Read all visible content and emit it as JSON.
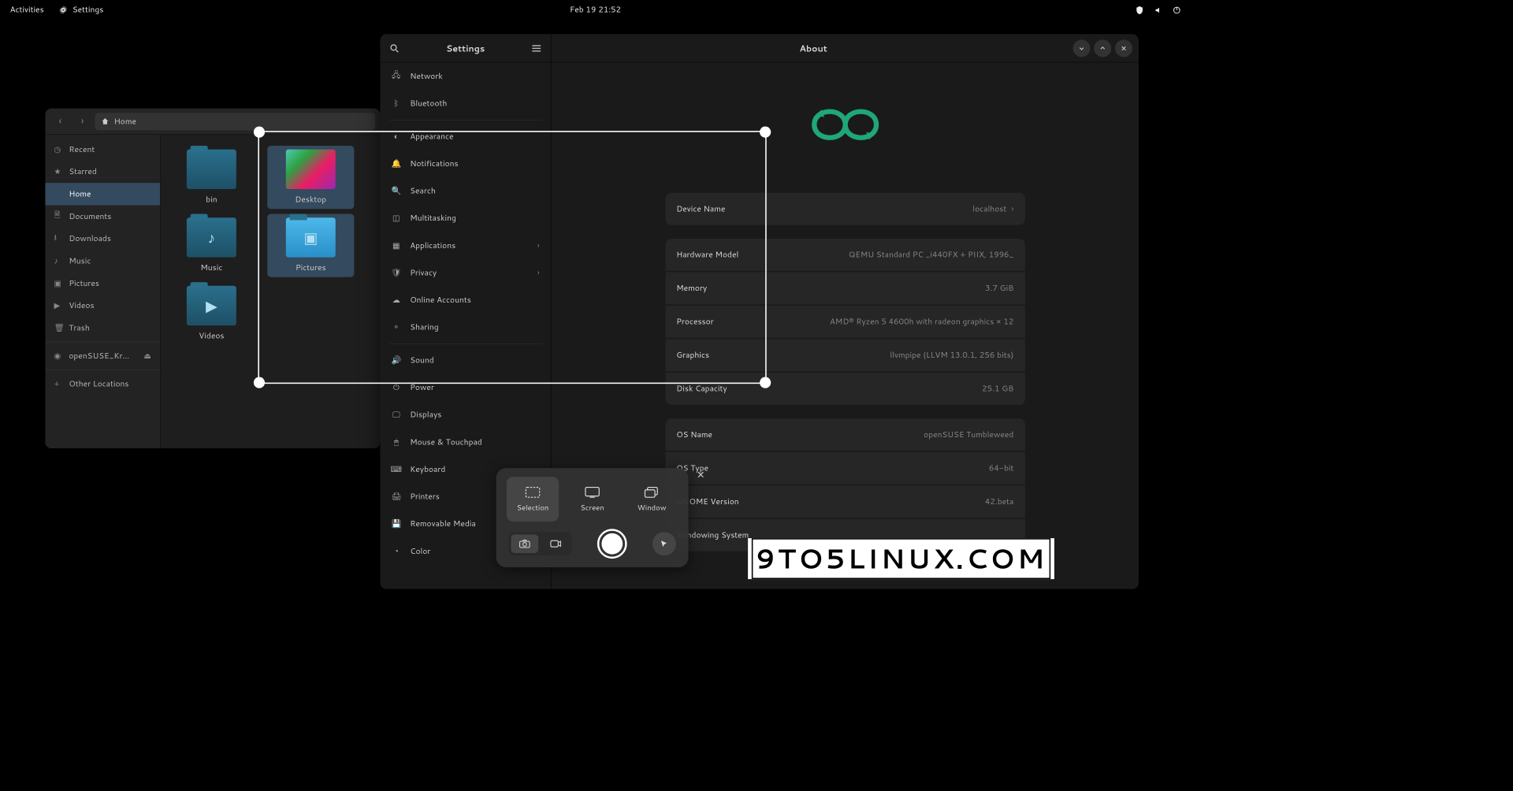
{
  "topbar": {
    "activities": "Activities",
    "settings": "Settings",
    "clock": "Feb 19  21:52"
  },
  "files": {
    "pathHome": "Home",
    "sidebar": {
      "recent": "Recent",
      "starred": "Starred",
      "home": "Home",
      "documents": "Documents",
      "downloads": "Downloads",
      "music": "Music",
      "pictures": "Pictures",
      "videos": "Videos",
      "trash": "Trash",
      "disk": "openSUSE_Kr…",
      "other": "Other Locations"
    },
    "items": {
      "bin": "bin",
      "desktop": "Desktop",
      "music": "Music",
      "pictures": "Pictures",
      "videos": "Videos"
    }
  },
  "settings": {
    "leftTitle": "Settings",
    "rightTitle": "About",
    "nav": {
      "network": "Network",
      "bluetooth": "Bluetooth",
      "appearance": "Appearance",
      "notifications": "Notifications",
      "search": "Search",
      "multitasking": "Multitasking",
      "applications": "Applications",
      "privacy": "Privacy",
      "onlineAccounts": "Online Accounts",
      "sharing": "Sharing",
      "sound": "Sound",
      "power": "Power",
      "displays": "Displays",
      "mouse": "Mouse & Touchpad",
      "keyboard": "Keyboard",
      "printers": "Printers",
      "removable": "Removable Media",
      "color": "Color"
    },
    "about": {
      "deviceNameLabel": "Device Name",
      "deviceNameValue": "localhost",
      "hardwareModelLabel": "Hardware Model",
      "hardwareModelValue": "QEMU Standard PC _i440FX + PIIX, 1996_",
      "memoryLabel": "Memory",
      "memoryValue": "3.7 GiB",
      "processorLabel": "Processor",
      "processorValue": "AMD® Ryzen 5 4600h with radeon graphics × 12",
      "graphicsLabel": "Graphics",
      "graphicsValue": "llvmpipe (LLVM 13.0.1, 256 bits)",
      "diskLabel": "Disk Capacity",
      "diskValue": "25.1 GB",
      "osNameLabel": "OS Name",
      "osNameValue": "openSUSE Tumbleweed",
      "osTypeLabel": "OS Type",
      "osTypeValue": "64-bit",
      "gnomeLabel": "GNOME Version",
      "gnomeValue": "42.beta",
      "windowingLabel": "Windowing System"
    }
  },
  "screenshot": {
    "selection": "Selection",
    "screen": "Screen",
    "window": "Window"
  },
  "watermark": "9TO5LINUX.COM"
}
